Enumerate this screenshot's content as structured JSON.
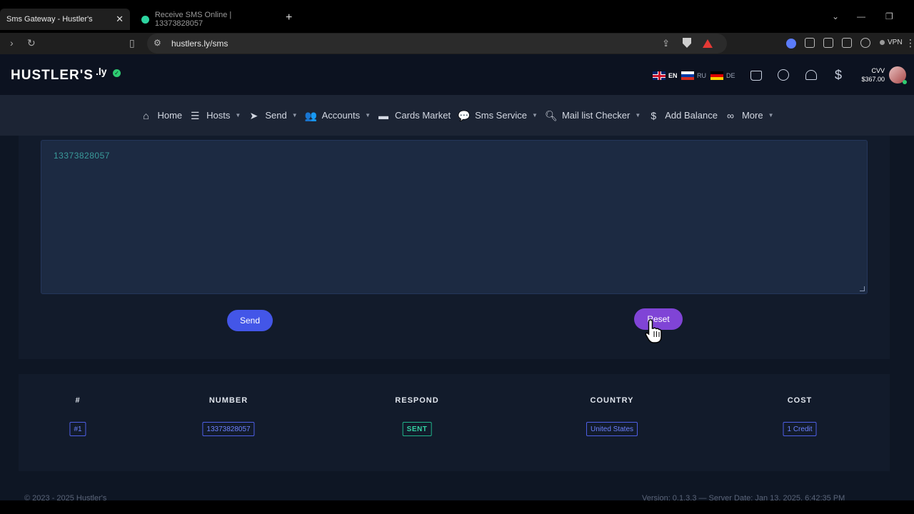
{
  "browser": {
    "tabs": [
      {
        "title": "Sms Gateway - Hustler's",
        "active": true
      },
      {
        "title": "Receive SMS Online | 13373828057",
        "active": false
      }
    ],
    "url": "hustlers.ly/sms",
    "vpn_label": "VPN"
  },
  "header": {
    "logo": "HUSTLER'S",
    "logo_suffix": ".ly",
    "languages": [
      {
        "code": "EN",
        "flag": "uk-flag"
      },
      {
        "code": "RU",
        "flag": "russia-flag"
      },
      {
        "code": "DE",
        "flag": "germany-flag"
      }
    ],
    "balance_label": "CVV",
    "balance_value": "$367.00"
  },
  "nav": {
    "items": [
      {
        "label": "Home",
        "icon": "home-icon",
        "caret": false
      },
      {
        "label": "Hosts",
        "icon": "server-icon",
        "caret": true
      },
      {
        "label": "Send",
        "icon": "paper-plane-icon",
        "caret": true
      },
      {
        "label": "Accounts",
        "icon": "users-icon",
        "caret": true
      },
      {
        "label": "Cards Market",
        "icon": "credit-card-icon",
        "caret": false
      },
      {
        "label": "Sms Service",
        "icon": "sms-icon",
        "caret": true
      },
      {
        "label": "Mail list Checker",
        "icon": "search-icon",
        "caret": true
      },
      {
        "label": "Add Balance",
        "icon": "dollar-icon",
        "caret": false
      },
      {
        "label": "More",
        "icon": "link-icon",
        "caret": true
      }
    ]
  },
  "form": {
    "textarea_value": "13373828057",
    "send_label": "Send",
    "reset_label": "Reset"
  },
  "table": {
    "headers": [
      "#",
      "NUMBER",
      "RESPOND",
      "COUNTRY",
      "COST"
    ],
    "rows": [
      [
        "#1",
        "13373828057",
        "SENT",
        "United States",
        "1 Credit"
      ]
    ]
  },
  "footer": {
    "copyright": "© 2023 - 2025 Hustler's",
    "version": "Version: 0.1.3.3 — Server Date: Jan 13, 2025, 6:42:35 PM"
  },
  "colors": {
    "accent_blue": "#4356e8",
    "accent_purple": "#8044d6",
    "status_green": "#35d3a3"
  }
}
